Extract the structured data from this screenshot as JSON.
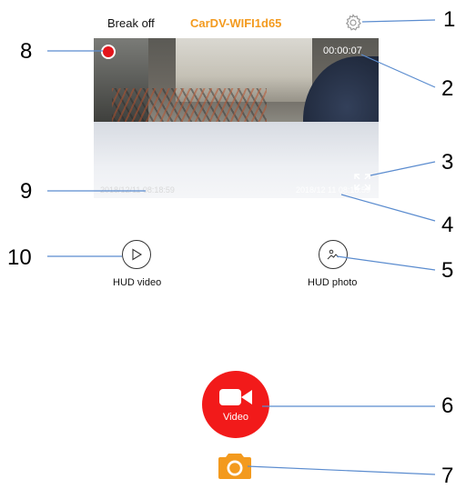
{
  "header": {
    "status_label": "Break off",
    "device_name": "CarDV-WIFI1d65",
    "settings_icon": "gear-icon"
  },
  "preview": {
    "timer": "00:00:07",
    "timestamp_right": "2018/12 11 08:18:59",
    "timestamp_left": "2018/12/11 08:18:59",
    "record_indicator_icon": "record-dot-icon",
    "fullscreen_icon": "expand-icon"
  },
  "hud": {
    "video_label": "HUD video",
    "photo_label": "HUD photo"
  },
  "controls": {
    "video_label": "Video",
    "video_icon": "video-camera-icon",
    "photo_icon": "camera-icon"
  },
  "callouts": [
    "1",
    "2",
    "3",
    "4",
    "5",
    "6",
    "7",
    "8",
    "9",
    "10"
  ],
  "colors": {
    "accent_orange": "#f39a1e",
    "record_red": "#e3151c",
    "video_button_red": "#f21a1a",
    "callout_line_blue": "#5b8ccf"
  }
}
